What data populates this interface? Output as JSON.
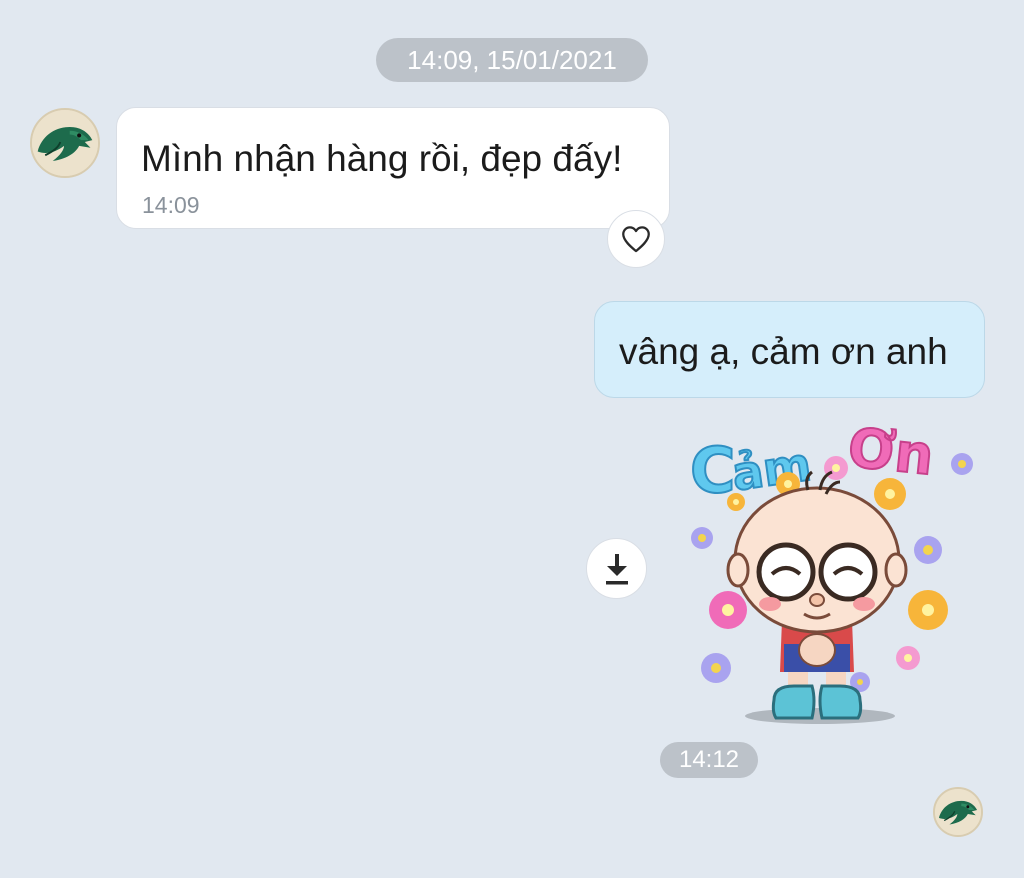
{
  "conversation": {
    "date_separator": "14:09, 15/01/2021",
    "messages": [
      {
        "direction": "incoming",
        "text": "Mình nhận hàng rồi, đẹp đấy!",
        "time": "14:09",
        "avatar_icon": "eagle-avatar-icon",
        "reaction_icon": "heart-outline-icon"
      },
      {
        "direction": "outgoing",
        "text": "vâng ạ, cảm ơn anh"
      },
      {
        "direction": "outgoing",
        "type": "sticker",
        "sticker_text": "Cảm ơn",
        "action_icon": "download-icon"
      }
    ],
    "last_time": "14:12",
    "seen_avatar_icon": "eagle-avatar-icon"
  },
  "colors": {
    "background": "#e1e8f0",
    "incoming_bubble": "#ffffff",
    "outgoing_bubble": "#d5eefb",
    "pill": "#bcc2c9"
  }
}
